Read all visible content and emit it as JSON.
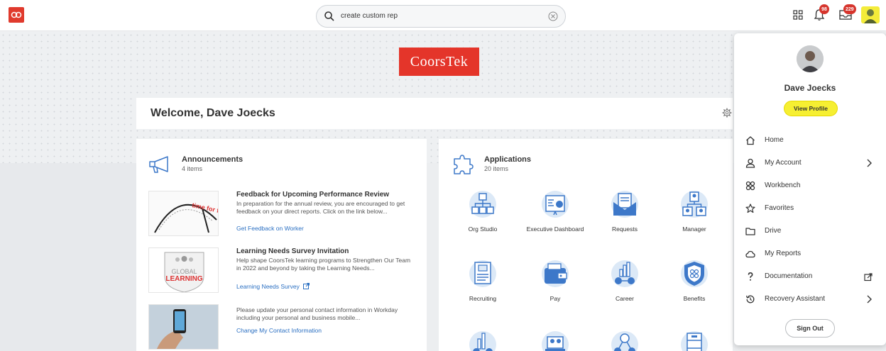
{
  "topbar": {
    "search_value": "create custom rep",
    "notifications_count": "98",
    "inbox_count": "229"
  },
  "brand": {
    "logo_text": "CoorsTek"
  },
  "welcome": {
    "title": "Welcome, Dave Joecks"
  },
  "announcements": {
    "title": "Announcements",
    "count": "4 items",
    "items": [
      {
        "title": "Feedback for Upcoming Performance Review",
        "desc": "In preparation for the annual review, you are encouraged to get feedback on your direct reports. Click on the link below...",
        "link": "Get Feedback on Worker",
        "thumb_text": "time for feedback"
      },
      {
        "title": "Learning Needs Survey Invitation",
        "desc": "Help shape CoorsTek learning programs to Strengthen Our Team in 2022 and beyond by taking the Learning Needs...",
        "link": "Learning Needs Survey",
        "thumb_top": "GLOBAL",
        "thumb_bottom": "LEARNING"
      },
      {
        "title": "",
        "desc": "Please update your personal contact information in Workday including your personal and business mobile...",
        "link": "Change My Contact Information"
      }
    ]
  },
  "applications": {
    "title": "Applications",
    "count": "20 items",
    "items": [
      {
        "label": "Org Studio"
      },
      {
        "label": "Executive Dashboard"
      },
      {
        "label": "Requests"
      },
      {
        "label": "Manager"
      },
      {
        "label": "Recruiting"
      },
      {
        "label": "Pay"
      },
      {
        "label": "Career"
      },
      {
        "label": "Benefits"
      }
    ]
  },
  "profile": {
    "name": "Dave Joecks",
    "view_profile": "View Profile",
    "menu": [
      {
        "label": "Home",
        "icon": "home-icon"
      },
      {
        "label": "My Account",
        "icon": "user-icon"
      },
      {
        "label": "Workbench",
        "icon": "workbench-icon"
      },
      {
        "label": "Favorites",
        "icon": "star-icon"
      },
      {
        "label": "Drive",
        "icon": "folder-icon"
      },
      {
        "label": "My Reports",
        "icon": "cloud-icon"
      },
      {
        "label": "Documentation",
        "icon": "question-icon"
      },
      {
        "label": "Recovery Assistant",
        "icon": "history-icon"
      }
    ],
    "sign_out": "Sign Out"
  },
  "colors": {
    "brand_red": "#e4352a",
    "highlight_yellow": "#f6ef32",
    "link_blue": "#2a6fc2",
    "app_blue": "#3d78c9"
  }
}
